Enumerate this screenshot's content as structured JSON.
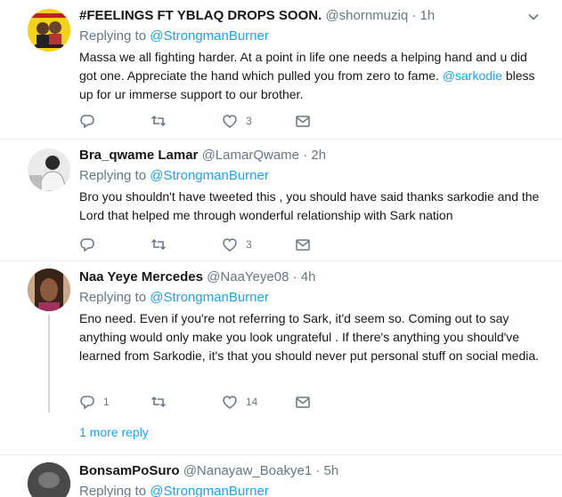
{
  "tweets": [
    {
      "name": "#FEELINGS FT YBLAQ DROPS SOON.",
      "handle": "@shornmuziq",
      "time": "1h",
      "replying_prefix": "Replying to",
      "replying_to": "@StrongmanBurner",
      "text_before": "Massa we all fighting harder. At a point in life one needs a helping hand and u did got one. Appreciate the hand which pulled you from zero to fame. ",
      "text_mention": "@sarkodie",
      "text_after": " bless up for ur immerse support to our brother.",
      "replies": "",
      "likes": "3"
    },
    {
      "name": "Bra_qwame Lamar",
      "handle": "@LamarQwame",
      "time": "2h",
      "replying_prefix": "Replying to",
      "replying_to": "@StrongmanBurner",
      "text": "Bro you shouldn't have tweeted this , you should have said thanks sarkodie and the Lord that helped me through wonderful relationship with Sark nation",
      "replies": "",
      "likes": "3"
    },
    {
      "name": "Naa Yeye Mercedes",
      "handle": "@NaaYeye08",
      "time": "4h",
      "replying_prefix": "Replying to",
      "replying_to": "@StrongmanBurner",
      "text": "Eno need. Even if you're not referring to Sark, it'd seem so. Coming out to say anything would only make you look ungrateful . If there's anything you should've learned from Sarkodie, it's that you should never put personal stuff on social media.",
      "replies": "1",
      "likes": "14"
    },
    {
      "name": "BonsamPoSuro",
      "handle": "@Nanayaw_Boakye1",
      "time": "5h",
      "replying_prefix": "Replying to",
      "replying_to": "@StrongmanBurner"
    }
  ],
  "more_replies_label": "1 more reply",
  "separator": "·",
  "colors": {
    "accent": "#1da1f2",
    "muted": "#657786",
    "divider": "#e6ecf0"
  },
  "icons": [
    "reply-icon",
    "retweet-icon",
    "like-icon",
    "message-icon",
    "chevron-down-icon"
  ]
}
